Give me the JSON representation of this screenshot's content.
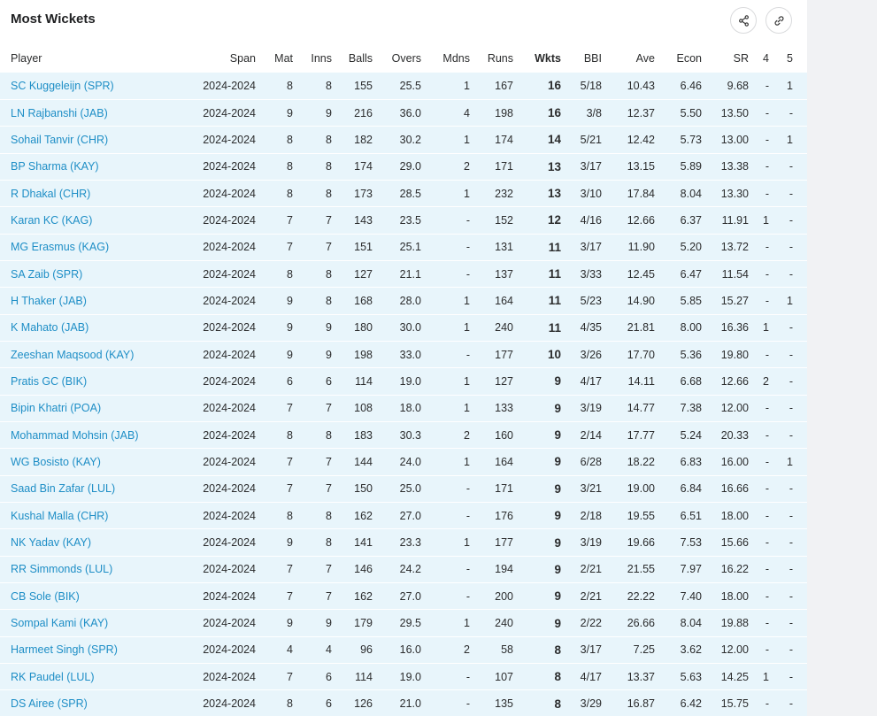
{
  "title": "Most Wickets",
  "columns": {
    "player": "Player",
    "span": "Span",
    "mat": "Mat",
    "inns": "Inns",
    "balls": "Balls",
    "overs": "Overs",
    "mdns": "Mdns",
    "runs": "Runs",
    "wkts": "Wkts",
    "bbi": "BBI",
    "ave": "Ave",
    "econ": "Econ",
    "sr": "SR",
    "four": "4",
    "five": "5"
  },
  "rows": [
    {
      "player": "SC Kuggeleijn (SPR)",
      "span": "2024-2024",
      "mat": "8",
      "inns": "8",
      "balls": "155",
      "overs": "25.5",
      "mdns": "1",
      "runs": "167",
      "wkts": "16",
      "bbi": "5/18",
      "ave": "10.43",
      "econ": "6.46",
      "sr": "9.68",
      "four": "-",
      "five": "1"
    },
    {
      "player": "LN Rajbanshi (JAB)",
      "span": "2024-2024",
      "mat": "9",
      "inns": "9",
      "balls": "216",
      "overs": "36.0",
      "mdns": "4",
      "runs": "198",
      "wkts": "16",
      "bbi": "3/8",
      "ave": "12.37",
      "econ": "5.50",
      "sr": "13.50",
      "four": "-",
      "five": "-"
    },
    {
      "player": "Sohail Tanvir (CHR)",
      "span": "2024-2024",
      "mat": "8",
      "inns": "8",
      "balls": "182",
      "overs": "30.2",
      "mdns": "1",
      "runs": "174",
      "wkts": "14",
      "bbi": "5/21",
      "ave": "12.42",
      "econ": "5.73",
      "sr": "13.00",
      "four": "-",
      "five": "1"
    },
    {
      "player": "BP Sharma (KAY)",
      "span": "2024-2024",
      "mat": "8",
      "inns": "8",
      "balls": "174",
      "overs": "29.0",
      "mdns": "2",
      "runs": "171",
      "wkts": "13",
      "bbi": "3/17",
      "ave": "13.15",
      "econ": "5.89",
      "sr": "13.38",
      "four": "-",
      "five": "-"
    },
    {
      "player": "R Dhakal (CHR)",
      "span": "2024-2024",
      "mat": "8",
      "inns": "8",
      "balls": "173",
      "overs": "28.5",
      "mdns": "1",
      "runs": "232",
      "wkts": "13",
      "bbi": "3/10",
      "ave": "17.84",
      "econ": "8.04",
      "sr": "13.30",
      "four": "-",
      "five": "-"
    },
    {
      "player": "Karan KC (KAG)",
      "span": "2024-2024",
      "mat": "7",
      "inns": "7",
      "balls": "143",
      "overs": "23.5",
      "mdns": "-",
      "runs": "152",
      "wkts": "12",
      "bbi": "4/16",
      "ave": "12.66",
      "econ": "6.37",
      "sr": "11.91",
      "four": "1",
      "five": "-"
    },
    {
      "player": "MG Erasmus (KAG)",
      "span": "2024-2024",
      "mat": "7",
      "inns": "7",
      "balls": "151",
      "overs": "25.1",
      "mdns": "-",
      "runs": "131",
      "wkts": "11",
      "bbi": "3/17",
      "ave": "11.90",
      "econ": "5.20",
      "sr": "13.72",
      "four": "-",
      "five": "-"
    },
    {
      "player": "SA Zaib (SPR)",
      "span": "2024-2024",
      "mat": "8",
      "inns": "8",
      "balls": "127",
      "overs": "21.1",
      "mdns": "-",
      "runs": "137",
      "wkts": "11",
      "bbi": "3/33",
      "ave": "12.45",
      "econ": "6.47",
      "sr": "11.54",
      "four": "-",
      "five": "-"
    },
    {
      "player": "H Thaker (JAB)",
      "span": "2024-2024",
      "mat": "9",
      "inns": "8",
      "balls": "168",
      "overs": "28.0",
      "mdns": "1",
      "runs": "164",
      "wkts": "11",
      "bbi": "5/23",
      "ave": "14.90",
      "econ": "5.85",
      "sr": "15.27",
      "four": "-",
      "five": "1"
    },
    {
      "player": "K Mahato (JAB)",
      "span": "2024-2024",
      "mat": "9",
      "inns": "9",
      "balls": "180",
      "overs": "30.0",
      "mdns": "1",
      "runs": "240",
      "wkts": "11",
      "bbi": "4/35",
      "ave": "21.81",
      "econ": "8.00",
      "sr": "16.36",
      "four": "1",
      "five": "-"
    },
    {
      "player": "Zeeshan Maqsood (KAY)",
      "span": "2024-2024",
      "mat": "9",
      "inns": "9",
      "balls": "198",
      "overs": "33.0",
      "mdns": "-",
      "runs": "177",
      "wkts": "10",
      "bbi": "3/26",
      "ave": "17.70",
      "econ": "5.36",
      "sr": "19.80",
      "four": "-",
      "five": "-"
    },
    {
      "player": "Pratis GC (BIK)",
      "span": "2024-2024",
      "mat": "6",
      "inns": "6",
      "balls": "114",
      "overs": "19.0",
      "mdns": "1",
      "runs": "127",
      "wkts": "9",
      "bbi": "4/17",
      "ave": "14.11",
      "econ": "6.68",
      "sr": "12.66",
      "four": "2",
      "five": "-"
    },
    {
      "player": "Bipin Khatri (POA)",
      "span": "2024-2024",
      "mat": "7",
      "inns": "7",
      "balls": "108",
      "overs": "18.0",
      "mdns": "1",
      "runs": "133",
      "wkts": "9",
      "bbi": "3/19",
      "ave": "14.77",
      "econ": "7.38",
      "sr": "12.00",
      "four": "-",
      "five": "-"
    },
    {
      "player": "Mohammad Mohsin (JAB)",
      "span": "2024-2024",
      "mat": "8",
      "inns": "8",
      "balls": "183",
      "overs": "30.3",
      "mdns": "2",
      "runs": "160",
      "wkts": "9",
      "bbi": "2/14",
      "ave": "17.77",
      "econ": "5.24",
      "sr": "20.33",
      "four": "-",
      "five": "-"
    },
    {
      "player": "WG Bosisto (KAY)",
      "span": "2024-2024",
      "mat": "7",
      "inns": "7",
      "balls": "144",
      "overs": "24.0",
      "mdns": "1",
      "runs": "164",
      "wkts": "9",
      "bbi": "6/28",
      "ave": "18.22",
      "econ": "6.83",
      "sr": "16.00",
      "four": "-",
      "five": "1"
    },
    {
      "player": "Saad Bin Zafar (LUL)",
      "span": "2024-2024",
      "mat": "7",
      "inns": "7",
      "balls": "150",
      "overs": "25.0",
      "mdns": "-",
      "runs": "171",
      "wkts": "9",
      "bbi": "3/21",
      "ave": "19.00",
      "econ": "6.84",
      "sr": "16.66",
      "four": "-",
      "five": "-"
    },
    {
      "player": "Kushal Malla (CHR)",
      "span": "2024-2024",
      "mat": "8",
      "inns": "8",
      "balls": "162",
      "overs": "27.0",
      "mdns": "-",
      "runs": "176",
      "wkts": "9",
      "bbi": "2/18",
      "ave": "19.55",
      "econ": "6.51",
      "sr": "18.00",
      "four": "-",
      "five": "-"
    },
    {
      "player": "NK Yadav (KAY)",
      "span": "2024-2024",
      "mat": "9",
      "inns": "8",
      "balls": "141",
      "overs": "23.3",
      "mdns": "1",
      "runs": "177",
      "wkts": "9",
      "bbi": "3/19",
      "ave": "19.66",
      "econ": "7.53",
      "sr": "15.66",
      "four": "-",
      "five": "-"
    },
    {
      "player": "RR Simmonds (LUL)",
      "span": "2024-2024",
      "mat": "7",
      "inns": "7",
      "balls": "146",
      "overs": "24.2",
      "mdns": "-",
      "runs": "194",
      "wkts": "9",
      "bbi": "2/21",
      "ave": "21.55",
      "econ": "7.97",
      "sr": "16.22",
      "four": "-",
      "five": "-"
    },
    {
      "player": "CB Sole (BIK)",
      "span": "2024-2024",
      "mat": "7",
      "inns": "7",
      "balls": "162",
      "overs": "27.0",
      "mdns": "-",
      "runs": "200",
      "wkts": "9",
      "bbi": "2/21",
      "ave": "22.22",
      "econ": "7.40",
      "sr": "18.00",
      "four": "-",
      "five": "-"
    },
    {
      "player": "Sompal Kami (KAY)",
      "span": "2024-2024",
      "mat": "9",
      "inns": "9",
      "balls": "179",
      "overs": "29.5",
      "mdns": "1",
      "runs": "240",
      "wkts": "9",
      "bbi": "2/22",
      "ave": "26.66",
      "econ": "8.04",
      "sr": "19.88",
      "four": "-",
      "five": "-"
    },
    {
      "player": "Harmeet Singh (SPR)",
      "span": "2024-2024",
      "mat": "4",
      "inns": "4",
      "balls": "96",
      "overs": "16.0",
      "mdns": "2",
      "runs": "58",
      "wkts": "8",
      "bbi": "3/17",
      "ave": "7.25",
      "econ": "3.62",
      "sr": "12.00",
      "four": "-",
      "five": "-"
    },
    {
      "player": "RK Paudel (LUL)",
      "span": "2024-2024",
      "mat": "7",
      "inns": "6",
      "balls": "114",
      "overs": "19.0",
      "mdns": "-",
      "runs": "107",
      "wkts": "8",
      "bbi": "4/17",
      "ave": "13.37",
      "econ": "5.63",
      "sr": "14.25",
      "four": "1",
      "five": "-"
    },
    {
      "player": "DS Airee (SPR)",
      "span": "2024-2024",
      "mat": "8",
      "inns": "6",
      "balls": "126",
      "overs": "21.0",
      "mdns": "-",
      "runs": "135",
      "wkts": "8",
      "bbi": "3/29",
      "ave": "16.87",
      "econ": "6.42",
      "sr": "15.75",
      "four": "-",
      "five": "-"
    }
  ]
}
